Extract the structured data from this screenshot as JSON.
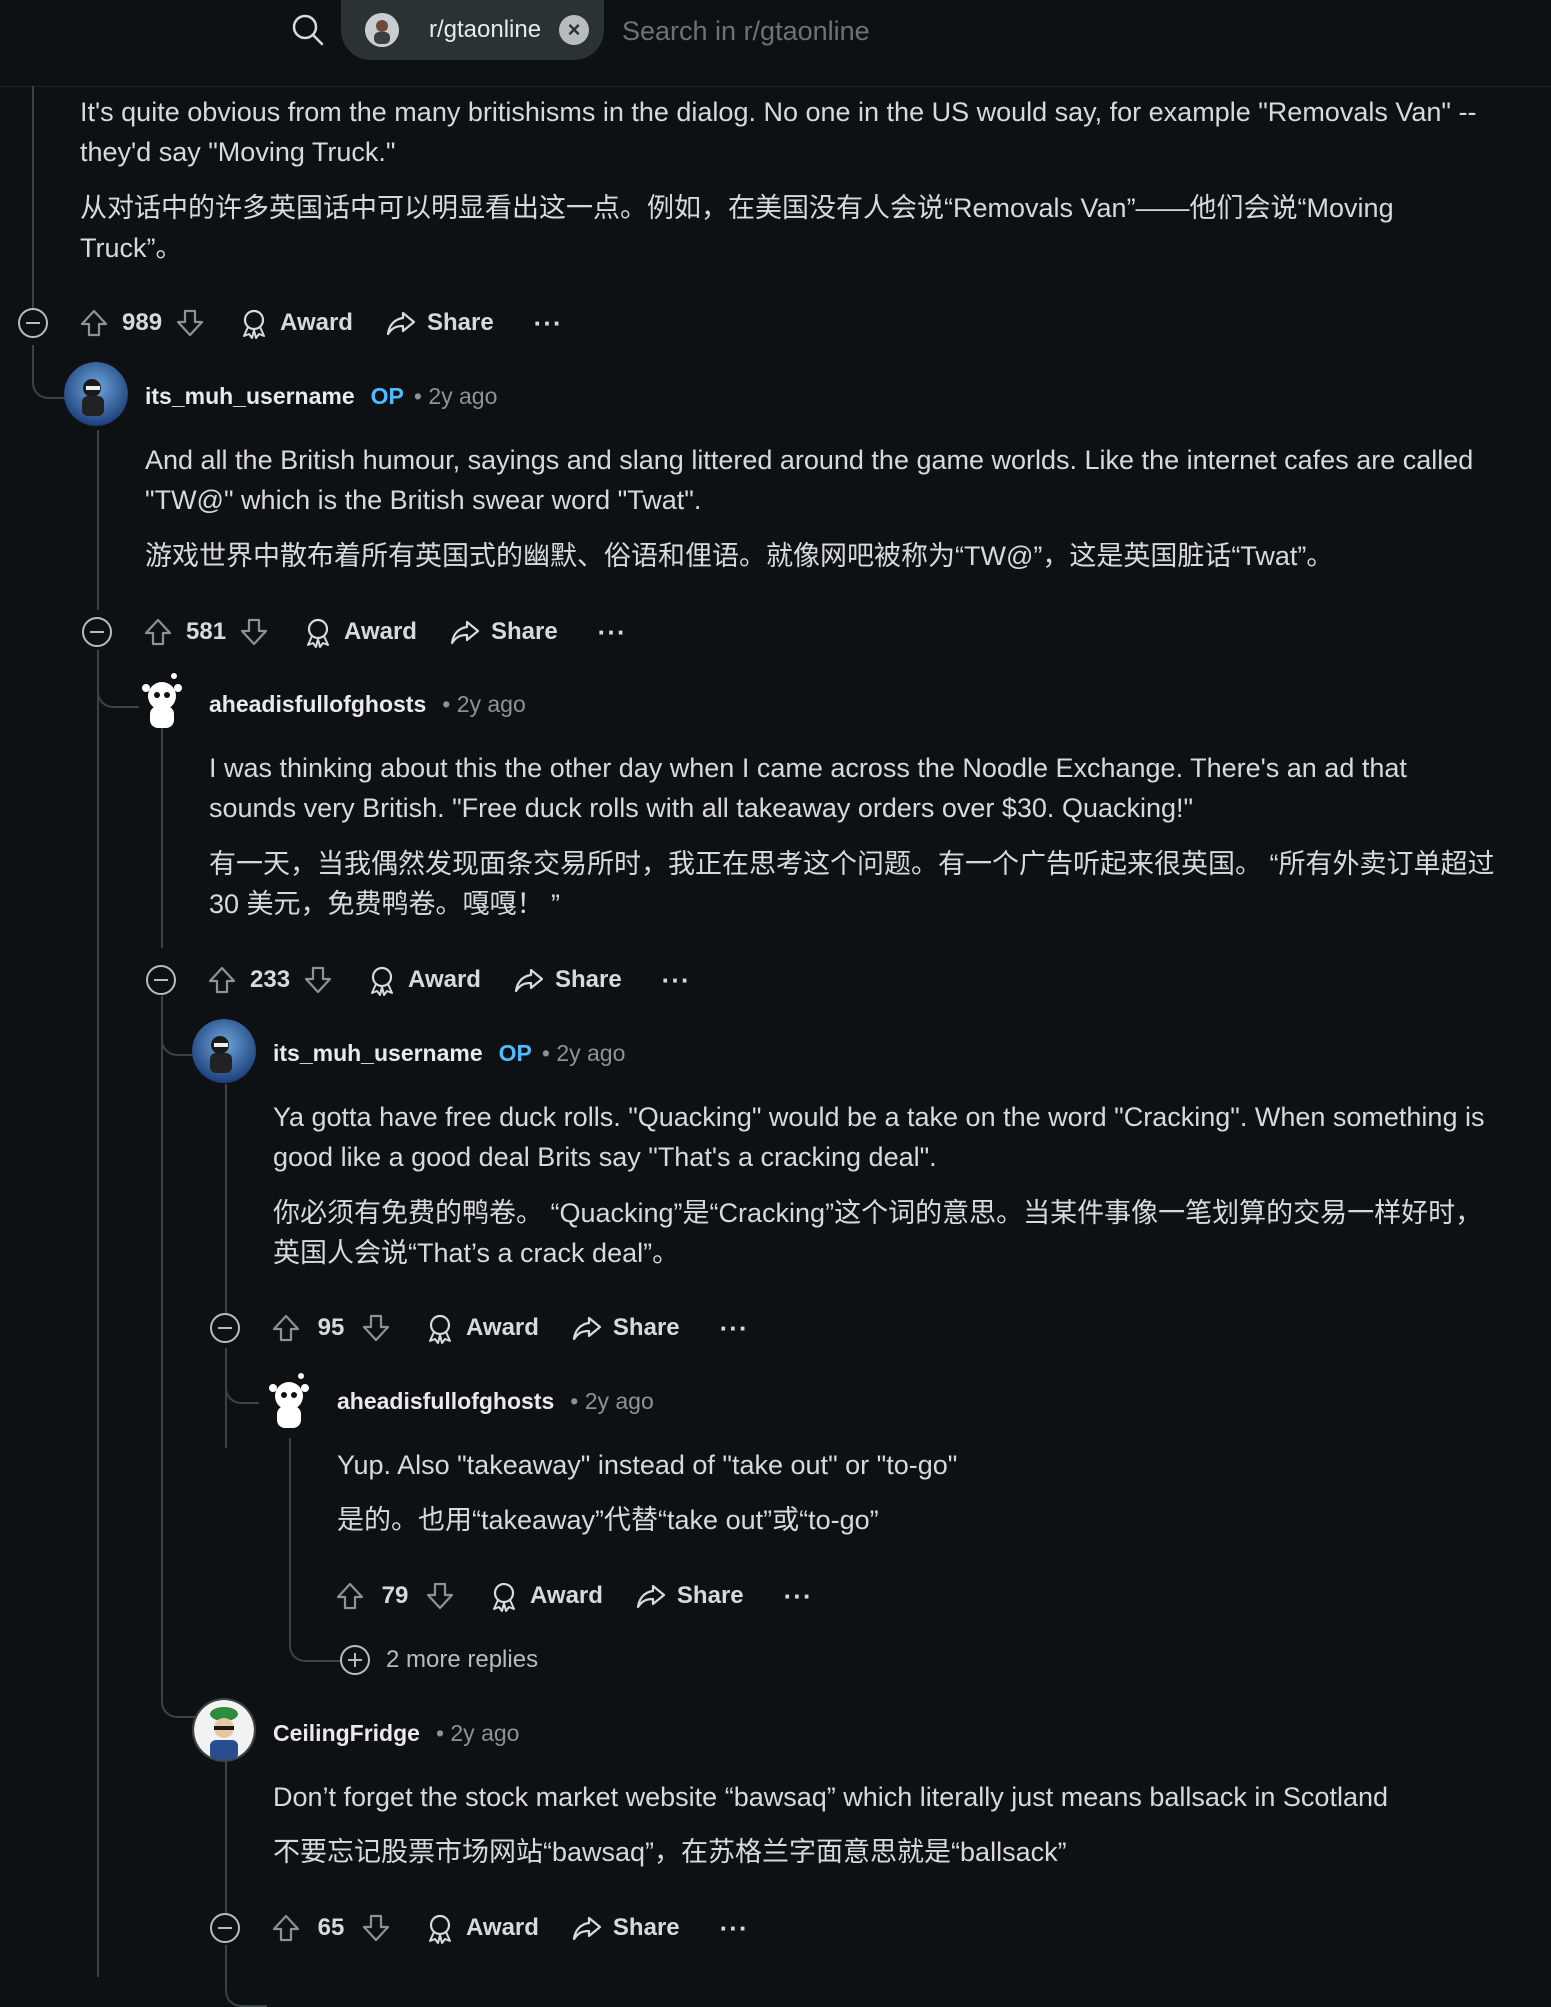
{
  "header": {
    "subreddit": "r/gtaonline",
    "search_placeholder": "Search in r/gtaonline",
    "icons": [
      "search-icon",
      "close-icon"
    ]
  },
  "comments": [
    {
      "text_en": "It's quite obvious from the many britishisms in the dialog. No one in the US would say, for example \"Removals Van\" -- they'd say \"Moving Truck.\"",
      "text_zh": "从对话中的许多英国话中可以明显看出这一点。例如，在美国没有人会说“Removals Van”——他们会说“Moving Truck”。",
      "score": "989"
    },
    {
      "author": "its_muh_username",
      "op": "OP",
      "age": "• 2y ago",
      "text_en": "And all the British humour, sayings and slang littered around the game worlds. Like the internet cafes are called \"TW@\" which is the British swear word \"Twat\".",
      "text_zh": "游戏世界中散布着所有英国式的幽默、俗语和俚语。就像网吧被称为“TW@”，这是英国脏话“Twat”。",
      "score": "581"
    },
    {
      "author": "aheadisfullofghosts",
      "age": "• 2y ago",
      "text_en": "I was thinking about this the other day when I came across the Noodle Exchange. There's an ad that sounds very British. \"Free duck rolls with all takeaway orders over $30. Quacking!\"",
      "text_zh": "有一天，当我偶然发现面条交易所时，我正在思考这个问题。有一个广告听起来很英国。 “所有外卖订单超过 30 美元，免费鸭卷。嘎嘎！ ”",
      "score": "233"
    },
    {
      "author": "its_muh_username",
      "op": "OP",
      "age": "• 2y ago",
      "text_en": "Ya gotta have free duck rolls. \"Quacking\" would be a take on the word \"Cracking\". When something is good like a good deal Brits say \"That's a cracking deal\".",
      "text_zh": "你必须有免费的鸭卷。 “Quacking”是“Cracking”这个词的意思。当某件事像一笔划算的交易一样好时，英国人会说“That’s a crack deal”。",
      "score": "95"
    },
    {
      "author": "aheadisfullofghosts",
      "age": "• 2y ago",
      "text_en": "Yup. Also \"takeaway\" instead of \"take out\" or \"to-go\"",
      "text_zh": "是的。也用“takeaway”代替“take out”或“to-go”",
      "score": "79",
      "more_replies": "2 more replies"
    },
    {
      "author": "CeilingFridge",
      "age": "• 2y ago",
      "text_en": "Don’t forget the stock market website “bawsaq” which literally just means ballsack in Scotland",
      "text_zh": "不要忘记股票市场网站“bawsaq”，在苏格兰字面意思就是“ballsack”",
      "score": "65"
    }
  ],
  "actions": {
    "award": "Award",
    "share": "Share",
    "more": "···"
  }
}
